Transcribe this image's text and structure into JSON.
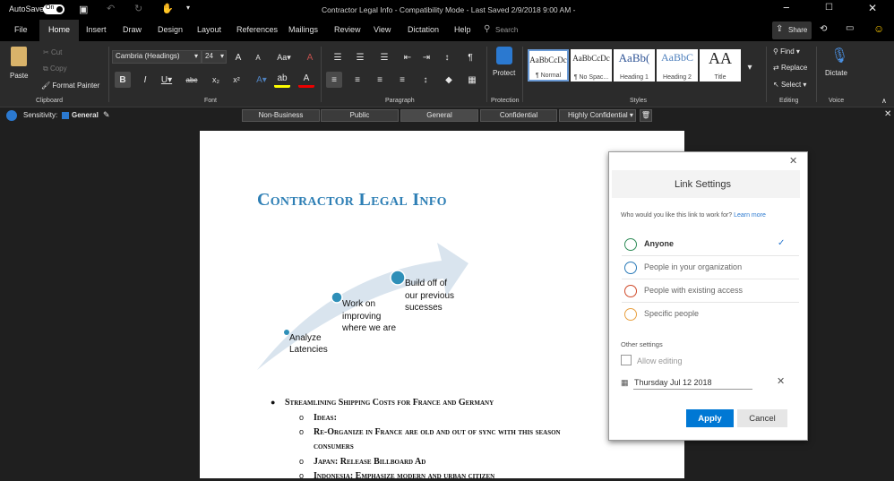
{
  "titlebar": {
    "autosave_label": "AutoSave",
    "autosave_state": "On",
    "title": "Contractor Legal Info  -  Compatibility Mode  -  Last Saved 2/9/2018 9:00 AM  -"
  },
  "tabs": [
    "File",
    "Home",
    "Insert",
    "Draw",
    "Design",
    "Layout",
    "References",
    "Mailings",
    "Review",
    "View",
    "Dictation",
    "Help"
  ],
  "search_placeholder": "Search",
  "share_label": "Share",
  "clipboard": {
    "paste": "Paste",
    "cut": "Cut",
    "copy": "Copy",
    "format_painter": "Format Painter",
    "group": "Clipboard"
  },
  "font": {
    "name": "Cambria (Headings)",
    "size": "24",
    "group": "Font"
  },
  "paragraph_group": "Paragraph",
  "protection": {
    "protect": "Protect",
    "group": "Protection"
  },
  "styles": {
    "items": [
      {
        "sample": "AaBbCcDc",
        "name": "¶ Normal"
      },
      {
        "sample": "AaBbCcDc",
        "name": "¶ No Spac..."
      },
      {
        "sample": "AaBb(",
        "name": "Heading 1"
      },
      {
        "sample": "AaBbC",
        "name": "Heading 2"
      },
      {
        "sample": "AA",
        "name": "Title"
      }
    ],
    "group": "Styles"
  },
  "editing": {
    "find": "Find",
    "replace": "Replace",
    "select": "Select",
    "group": "Editing"
  },
  "voice": {
    "dictate": "Dictate",
    "group": "Voice"
  },
  "sensitivity": {
    "label": "Sensitivity:",
    "value": "General",
    "options": [
      "Non-Business",
      "Public",
      "General",
      "Confidential",
      "Highly Confidential"
    ]
  },
  "document": {
    "title": "Contractor Legal Info",
    "smartart": [
      "Analyze Latencies",
      "Work on improving where we are",
      "Build off of our previous sucesses"
    ],
    "bullet": "Streamlining Shipping Costs for France and Germany",
    "sub_items": [
      "Ideas:",
      "Re-Organize in France are old and out of sync with this season",
      "consumers",
      "Japan: Release  Billboard Ad",
      "Indonesia: Emphasize modern and urban citizen"
    ]
  },
  "dialog": {
    "title": "Link Settings",
    "question": "Who would you like this link to work for?",
    "learn_more": "Learn more",
    "options": [
      {
        "label": "Anyone",
        "selected": true,
        "color": "#2e8b57"
      },
      {
        "label": "People in your organization",
        "selected": false,
        "color": "#2a7ab8"
      },
      {
        "label": "People with existing access",
        "selected": false,
        "color": "#d04a2a"
      },
      {
        "label": "Specific people",
        "selected": false,
        "color": "#e8a040"
      }
    ],
    "other_settings": "Other settings",
    "allow_editing": "Allow editing",
    "expiry_date": "Thursday Jul 12 2018",
    "apply": "Apply",
    "cancel": "Cancel"
  }
}
